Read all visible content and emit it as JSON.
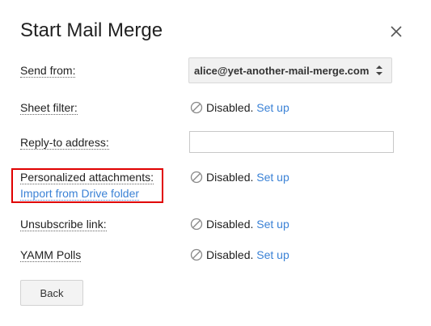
{
  "dialog": {
    "title": "Start Mail Merge",
    "close_icon": "close-icon"
  },
  "send_from": {
    "label": "Send from:",
    "value": "alice@yet-another-mail-merge.com"
  },
  "sheet_filter": {
    "label": "Sheet filter:",
    "status": "Disabled.",
    "action": "Set up"
  },
  "reply_to": {
    "label": "Reply-to address:",
    "value": ""
  },
  "attachments": {
    "label": "Personalized attachments:",
    "link": "Import from Drive folder",
    "status": "Disabled.",
    "action": "Set up"
  },
  "unsubscribe": {
    "label": "Unsubscribe link:",
    "status": "Disabled.",
    "action": "Set up"
  },
  "polls": {
    "label": "YAMM Polls",
    "status": "Disabled.",
    "action": "Set up"
  },
  "footer": {
    "back_label": "Back"
  },
  "colors": {
    "link": "#3b82d6",
    "highlight": "#e00000"
  }
}
